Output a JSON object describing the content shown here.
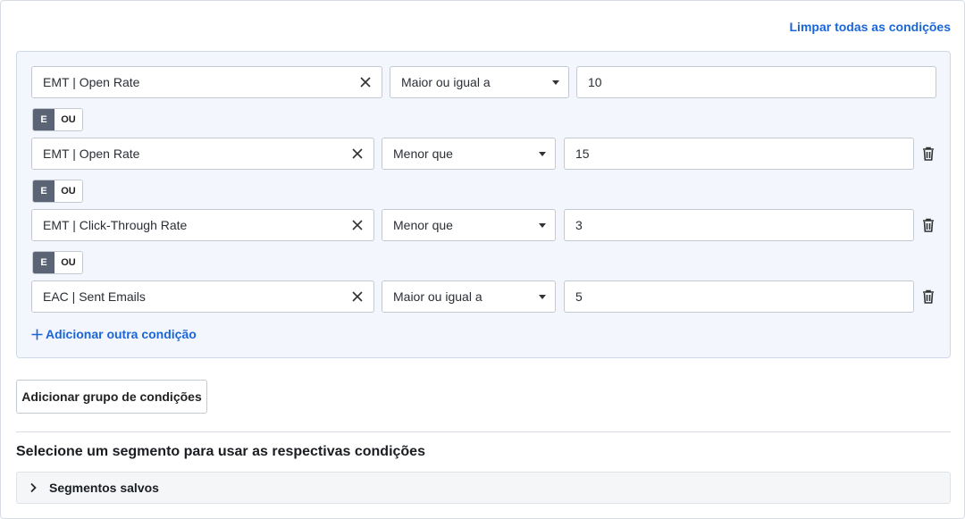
{
  "header": {
    "clear_all_label": "Limpar todas as condições"
  },
  "conditions": [
    {
      "field": "EMT | Open Rate",
      "operator": "Maior ou igual a",
      "value": "10",
      "deletable": false
    },
    {
      "field": "EMT | Open Rate",
      "operator": "Menor que",
      "value": "15",
      "deletable": true
    },
    {
      "field": "EMT | Click-Through Rate",
      "operator": "Menor que",
      "value": "3",
      "deletable": true
    },
    {
      "field": "EAC | Sent Emails",
      "operator": "Maior ou igual a",
      "value": "5",
      "deletable": true
    }
  ],
  "connectors": [
    {
      "and_label": "E",
      "or_label": "OU",
      "selected": "E"
    },
    {
      "and_label": "E",
      "or_label": "OU",
      "selected": "E"
    },
    {
      "and_label": "E",
      "or_label": "OU",
      "selected": "E"
    }
  ],
  "add_condition_label": "Adicionar outra condição",
  "add_group_label": "Adicionar grupo de condições",
  "segment_section": {
    "title": "Selecione um segmento para usar as respectivas condições",
    "saved_segments_label": "Segmentos salvos"
  },
  "colors": {
    "accent": "#1a66d9",
    "toggle_selected": "#5b6474",
    "group_bg": "#f3f6fc"
  }
}
